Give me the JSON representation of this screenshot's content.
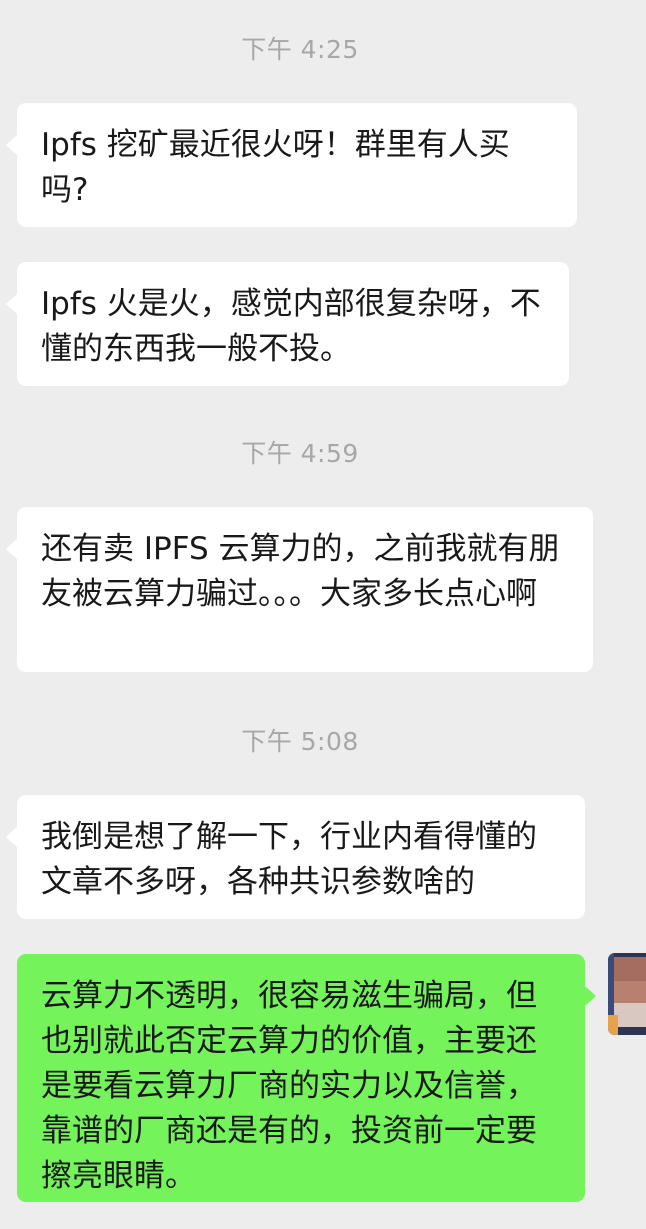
{
  "chat": {
    "timestamps": [
      "下午 4:25",
      "下午 4:59",
      "下午 5:08"
    ],
    "messages": [
      {
        "direction": "incoming",
        "text": "Ipfs 挖矿最近很火呀！群里有人买吗?"
      },
      {
        "direction": "incoming",
        "text": "Ipfs 火是火，感觉内部很复杂呀，不懂的东西我一般不投。"
      },
      {
        "direction": "incoming",
        "text": "还有卖 IPFS 云算力的，之前我就有朋友被云算力骗过。。。大家多长点心啊"
      },
      {
        "direction": "incoming",
        "text": "我倒是想了解一下，行业内看得懂的文章不多呀，各种共识参数啥的"
      },
      {
        "direction": "outgoing",
        "text": "云算力不透明，很容易滋生骗局，但也别就此否定云算力的价值，主要还是要看云算力厂商的实力以及信誉，靠谱的厂商还是有的，投资前一定要擦亮眼睛。"
      }
    ]
  },
  "colors": {
    "background": "#ededed",
    "incoming_bubble": "#ffffff",
    "outgoing_bubble": "#74f45a",
    "timestamp_text": "#a7a7a7"
  }
}
